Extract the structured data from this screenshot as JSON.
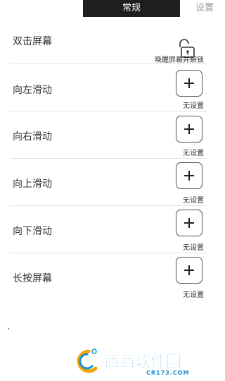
{
  "header": {
    "tab_general": "常规",
    "tab_settings": "设置"
  },
  "rows": [
    {
      "label": "双击屏幕",
      "caption": "唤醒屏幕并解锁",
      "icon": "unlock-icon"
    },
    {
      "label": "向左滑动",
      "caption": "无设置",
      "icon": "plus-icon"
    },
    {
      "label": "向右滑动",
      "caption": "无设置",
      "icon": "plus-icon"
    },
    {
      "label": "向上滑动",
      "caption": "无设置",
      "icon": "plus-icon"
    },
    {
      "label": "向下滑动",
      "caption": "无设置",
      "icon": "plus-icon"
    },
    {
      "label": "长按屏幕",
      "caption": "无设置",
      "icon": "plus-icon"
    }
  ],
  "watermark": {
    "brand": "西西软件园",
    "site": "CR173.COM"
  }
}
